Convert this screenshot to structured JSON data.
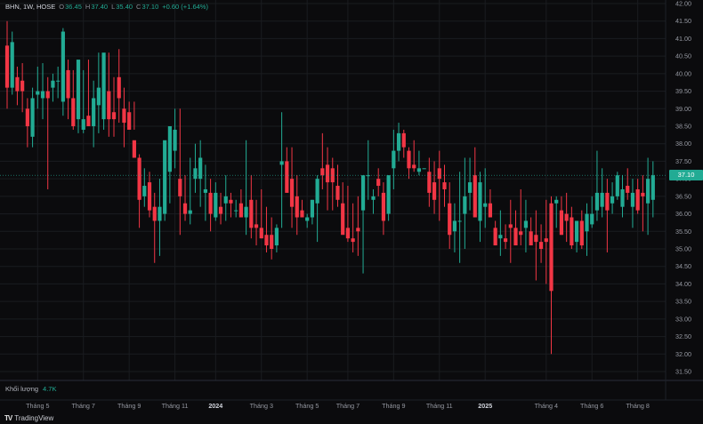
{
  "header": {
    "symbol": "BHN, 1W, HOSE",
    "open_label": "O",
    "open": "36.45",
    "high_label": "H",
    "high": "37.40",
    "low_label": "L",
    "low": "35.40",
    "close_label": "C",
    "close": "37.10",
    "change": "+0.60 (+1.64%)"
  },
  "volume": {
    "label": "Khối lượng",
    "value": "4.7K"
  },
  "brand": {
    "name": "TradingView",
    "logo": "TV"
  },
  "last_price_tag": "37.10",
  "colors": {
    "up": "#22ab94",
    "down": "#f23645",
    "background": "#0b0b0d",
    "grid": "#1a1c20",
    "text": "#b2b5be"
  },
  "chart_data": {
    "type": "candlestick",
    "y_axis": {
      "ylim": [
        31.5,
        42.0
      ],
      "ticks": [
        "42.00",
        "41.50",
        "41.00",
        "40.50",
        "40.00",
        "39.50",
        "39.00",
        "38.50",
        "38.00",
        "37.50",
        "37.00",
        "36.50",
        "36.00",
        "35.50",
        "35.00",
        "34.50",
        "34.00",
        "33.50",
        "33.00",
        "32.50",
        "32.00",
        "31.50"
      ]
    },
    "x_axis": {
      "ticks": [
        {
          "label": "Tháng 5",
          "i": 6
        },
        {
          "label": "Tháng 7",
          "i": 15
        },
        {
          "label": "Tháng 9",
          "i": 24
        },
        {
          "label": "Tháng 11",
          "i": 33
        },
        {
          "label": "2024",
          "i": 41
        },
        {
          "label": "Tháng 3",
          "i": 50
        },
        {
          "label": "Tháng 5",
          "i": 59
        },
        {
          "label": "Tháng 7",
          "i": 67
        },
        {
          "label": "Tháng 9",
          "i": 76
        },
        {
          "label": "Tháng 11",
          "i": 85
        },
        {
          "label": "2025",
          "i": 94
        },
        {
          "label": "Tháng 4",
          "i": 106
        },
        {
          "label": "Tháng 6",
          "i": 115
        },
        {
          "label": "Tháng 8",
          "i": 124
        }
      ]
    },
    "candles": [
      [
        40.8,
        41.5,
        39.0,
        39.6
      ],
      [
        39.6,
        41.2,
        39.4,
        40.9
      ],
      [
        39.9,
        40.2,
        39.1,
        39.5
      ],
      [
        39.8,
        40.3,
        38.9,
        39.5
      ],
      [
        39.0,
        39.3,
        37.9,
        38.5
      ],
      [
        38.2,
        39.6,
        37.9,
        39.3
      ],
      [
        39.4,
        40.2,
        39.0,
        39.5
      ],
      [
        39.3,
        40.3,
        38.7,
        39.5
      ],
      [
        39.5,
        39.9,
        36.7,
        39.3
      ],
      [
        39.6,
        40.0,
        39.2,
        39.8
      ],
      [
        39.8,
        40.2,
        39.3,
        39.8
      ],
      [
        39.2,
        41.3,
        38.8,
        41.2
      ],
      [
        40.1,
        40.4,
        38.7,
        39.3
      ],
      [
        39.3,
        40.1,
        38.4,
        38.5
      ],
      [
        38.7,
        40.3,
        38.3,
        40.4
      ],
      [
        38.4,
        40.1,
        38.3,
        38.7
      ],
      [
        38.8,
        40.4,
        38.5,
        38.5
      ],
      [
        38.5,
        39.8,
        37.9,
        39.3
      ],
      [
        39.1,
        40.6,
        38.3,
        39.6
      ],
      [
        38.7,
        40.4,
        38.4,
        40.6
      ],
      [
        39.5,
        40.6,
        38.2,
        38.7
      ],
      [
        38.9,
        39.9,
        38.2,
        38.7
      ],
      [
        39.9,
        40.7,
        38.6,
        39.3
      ],
      [
        39.0,
        39.6,
        37.9,
        38.6
      ],
      [
        38.9,
        39.2,
        38.7,
        38.4
      ],
      [
        38.1,
        39.2,
        38.4,
        37.6
      ],
      [
        37.6,
        37.7,
        35.6,
        36.4
      ],
      [
        36.5,
        37.3,
        36.2,
        36.8
      ],
      [
        36.9,
        37.2,
        35.9,
        36.1
      ],
      [
        36.2,
        36.6,
        34.6,
        35.8
      ],
      [
        35.8,
        37.0,
        34.8,
        36.2
      ],
      [
        36.0,
        37.2,
        35.8,
        38.1
      ],
      [
        37.2,
        38.5,
        36.3,
        38.5
      ],
      [
        37.8,
        39.0,
        37.3,
        38.4
      ],
      [
        37.0,
        39.0,
        35.4,
        36.5
      ],
      [
        36.3,
        37.1,
        35.8,
        36.0
      ],
      [
        36.0,
        37.6,
        35.7,
        36.1
      ],
      [
        37.0,
        38.0,
        36.6,
        37.3
      ],
      [
        37.0,
        38.1,
        36.2,
        37.6
      ],
      [
        36.6,
        37.4,
        35.8,
        36.7
      ],
      [
        36.6,
        37.0,
        35.5,
        36.0
      ],
      [
        35.9,
        36.9,
        35.8,
        36.6
      ],
      [
        36.2,
        36.6,
        35.7,
        36.0
      ],
      [
        36.3,
        37.1,
        35.8,
        36.5
      ],
      [
        36.4,
        36.6,
        35.9,
        36.3
      ],
      [
        36.1,
        36.4,
        35.9,
        36.1
      ],
      [
        36.3,
        36.7,
        35.9,
        35.9
      ],
      [
        35.9,
        38.1,
        35.4,
        36.2
      ],
      [
        36.4,
        37.1,
        35.3,
        35.6
      ],
      [
        35.7,
        36.4,
        35.1,
        35.6
      ],
      [
        35.6,
        36.7,
        35.3,
        35.3
      ],
      [
        35.4,
        36.2,
        34.9,
        35.1
      ],
      [
        35.4,
        35.9,
        34.7,
        35.0
      ],
      [
        35.1,
        35.7,
        34.9,
        35.6
      ],
      [
        37.4,
        38.9,
        35.6,
        37.5
      ],
      [
        37.5,
        37.9,
        36.6,
        36.6
      ],
      [
        37.0,
        37.9,
        35.6,
        36.2
      ],
      [
        36.5,
        37.1,
        35.4,
        35.9
      ],
      [
        36.1,
        36.4,
        35.9,
        35.9
      ],
      [
        35.8,
        36.0,
        35.6,
        35.9
      ],
      [
        35.9,
        36.4,
        35.7,
        36.4
      ],
      [
        36.3,
        37.1,
        35.2,
        37.0
      ],
      [
        37.3,
        38.3,
        36.7,
        37.1
      ],
      [
        37.4,
        37.9,
        36.1,
        36.9
      ],
      [
        37.3,
        37.6,
        36.1,
        36.9
      ],
      [
        36.8,
        37.4,
        36.2,
        36.4
      ],
      [
        36.3,
        36.9,
        35.6,
        35.4
      ],
      [
        35.6,
        36.8,
        35.2,
        35.3
      ],
      [
        35.3,
        36.3,
        34.9,
        35.2
      ],
      [
        35.6,
        36.5,
        34.8,
        35.5
      ],
      [
        36.1,
        37.0,
        34.3,
        37.1
      ],
      [
        37.1,
        38.1,
        36.4,
        37.1
      ],
      [
        36.4,
        36.7,
        36.0,
        36.5
      ],
      [
        37.0,
        37.3,
        36.5,
        36.8
      ],
      [
        36.6,
        36.9,
        35.4,
        35.8
      ],
      [
        36.0,
        37.1,
        35.8,
        37.1
      ],
      [
        37.3,
        38.4,
        36.7,
        37.8
      ],
      [
        37.8,
        38.6,
        37.5,
        38.3
      ],
      [
        38.3,
        38.4,
        37.6,
        37.9
      ],
      [
        37.8,
        37.9,
        37.0,
        37.3
      ],
      [
        37.4,
        38.1,
        37.2,
        37.3
      ],
      [
        37.2,
        37.8,
        37.1,
        37.3
      ],
      [
        37.3,
        37.3,
        37.3,
        37.3
      ],
      [
        37.2,
        37.6,
        36.2,
        36.6
      ],
      [
        36.9,
        37.5,
        36.0,
        36.4
      ],
      [
        37.3,
        37.8,
        35.8,
        37.0
      ],
      [
        36.9,
        37.4,
        36.2,
        36.7
      ],
      [
        36.3,
        36.9,
        35.0,
        35.4
      ],
      [
        35.5,
        36.3,
        34.9,
        35.8
      ],
      [
        35.8,
        37.2,
        34.6,
        35.8
      ],
      [
        36.0,
        37.6,
        35.0,
        36.5
      ],
      [
        36.6,
        37.6,
        36.1,
        36.9
      ],
      [
        37.1,
        37.9,
        36.1,
        35.9
      ],
      [
        35.8,
        37.2,
        35.2,
        36.9
      ],
      [
        36.2,
        37.3,
        35.6,
        36.3
      ],
      [
        36.3,
        36.7,
        35.9,
        35.9
      ],
      [
        35.6,
        35.8,
        35.1,
        35.1
      ],
      [
        35.3,
        36.1,
        34.8,
        35.4
      ],
      [
        35.3,
        35.7,
        35.0,
        35.2
      ],
      [
        35.7,
        36.4,
        34.6,
        35.6
      ],
      [
        35.6,
        36.1,
        35.4,
        35.1
      ],
      [
        35.5,
        36.7,
        35.1,
        35.4
      ],
      [
        35.6,
        36.4,
        34.9,
        35.8
      ],
      [
        35.5,
        35.9,
        35.3,
        35.1
      ],
      [
        35.4,
        36.1,
        34.1,
        35.2
      ],
      [
        35.2,
        35.7,
        34.6,
        35.0
      ],
      [
        35.3,
        36.4,
        34.0,
        35.2
      ],
      [
        36.3,
        36.5,
        32.0,
        33.8
      ],
      [
        36.3,
        36.5,
        35.6,
        36.4
      ],
      [
        36.1,
        36.5,
        35.4,
        35.4
      ],
      [
        36.0,
        36.6,
        35.2,
        35.8
      ],
      [
        35.9,
        36.2,
        35.0,
        35.1
      ],
      [
        35.2,
        35.7,
        34.9,
        35.8
      ],
      [
        35.8,
        36.1,
        35.0,
        35.1
      ],
      [
        35.5,
        36.3,
        34.8,
        36.0
      ],
      [
        35.7,
        36.5,
        35.6,
        36.0
      ],
      [
        36.1,
        37.8,
        35.8,
        36.6
      ],
      [
        36.2,
        37.3,
        35.9,
        36.6
      ],
      [
        36.6,
        37.0,
        34.9,
        36.1
      ],
      [
        36.3,
        36.9,
        36.0,
        36.5
      ],
      [
        36.5,
        37.2,
        36.4,
        37.1
      ],
      [
        36.2,
        37.1,
        35.9,
        36.7
      ],
      [
        36.8,
        37.3,
        36.4,
        36.6
      ],
      [
        36.2,
        37.0,
        35.6,
        36.6
      ],
      [
        36.7,
        37.0,
        36.0,
        36.1
      ],
      [
        36.6,
        37.1,
        35.5,
        36.5
      ],
      [
        36.3,
        37.6,
        35.4,
        37.0
      ],
      [
        36.4,
        37.5,
        35.9,
        37.1
      ]
    ]
  }
}
